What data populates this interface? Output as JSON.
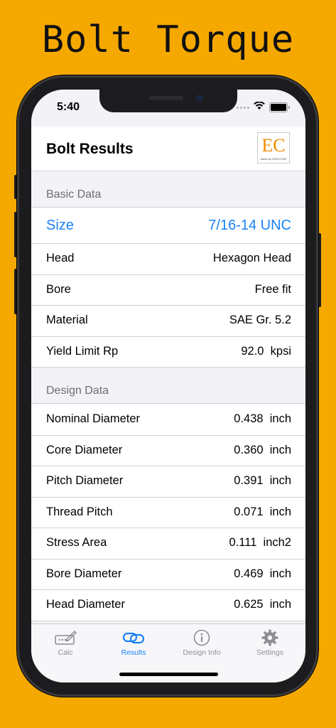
{
  "promo_title": "Bolt Torque",
  "status": {
    "time": "5:40"
  },
  "nav": {
    "title": "Bolt Results",
    "logo_text": "EC",
    "logo_sub": "Made by ENGCODE"
  },
  "basic": {
    "header": "Basic Data",
    "size": {
      "label": "Size",
      "value": "7/16-14 UNC"
    },
    "rows": [
      {
        "label": "Head",
        "value": "Hexagon Head"
      },
      {
        "label": "Bore",
        "value": "Free fit"
      },
      {
        "label": "Material",
        "value": "SAE Gr. 5.2"
      },
      {
        "label": "Yield Limit Rp",
        "value": "92.0  kpsi"
      }
    ]
  },
  "design": {
    "header": "Design Data",
    "rows": [
      {
        "label": "Nominal Diameter",
        "value": "0.438  inch"
      },
      {
        "label": "Core Diameter",
        "value": "0.360  inch"
      },
      {
        "label": "Pitch Diameter",
        "value": "0.391  inch"
      },
      {
        "label": "Thread Pitch",
        "value": "0.071  inch"
      },
      {
        "label": "Stress Area",
        "value": "0.111  inch2"
      },
      {
        "label": "Bore Diameter",
        "value": "0.469  inch"
      },
      {
        "label": "Head Diameter",
        "value": "0.625  inch"
      }
    ]
  },
  "tabs": [
    {
      "label": "Calc",
      "icon": "calculator-pen-icon",
      "active": false
    },
    {
      "label": "Results",
      "icon": "link-icon",
      "active": true
    },
    {
      "label": "Design Info",
      "icon": "info-icon",
      "active": false
    },
    {
      "label": "Settings",
      "icon": "gear-icon",
      "active": false
    }
  ],
  "colors": {
    "background": "#F5A800",
    "accent": "#1a82f7",
    "secondary": "#8e8e93"
  }
}
